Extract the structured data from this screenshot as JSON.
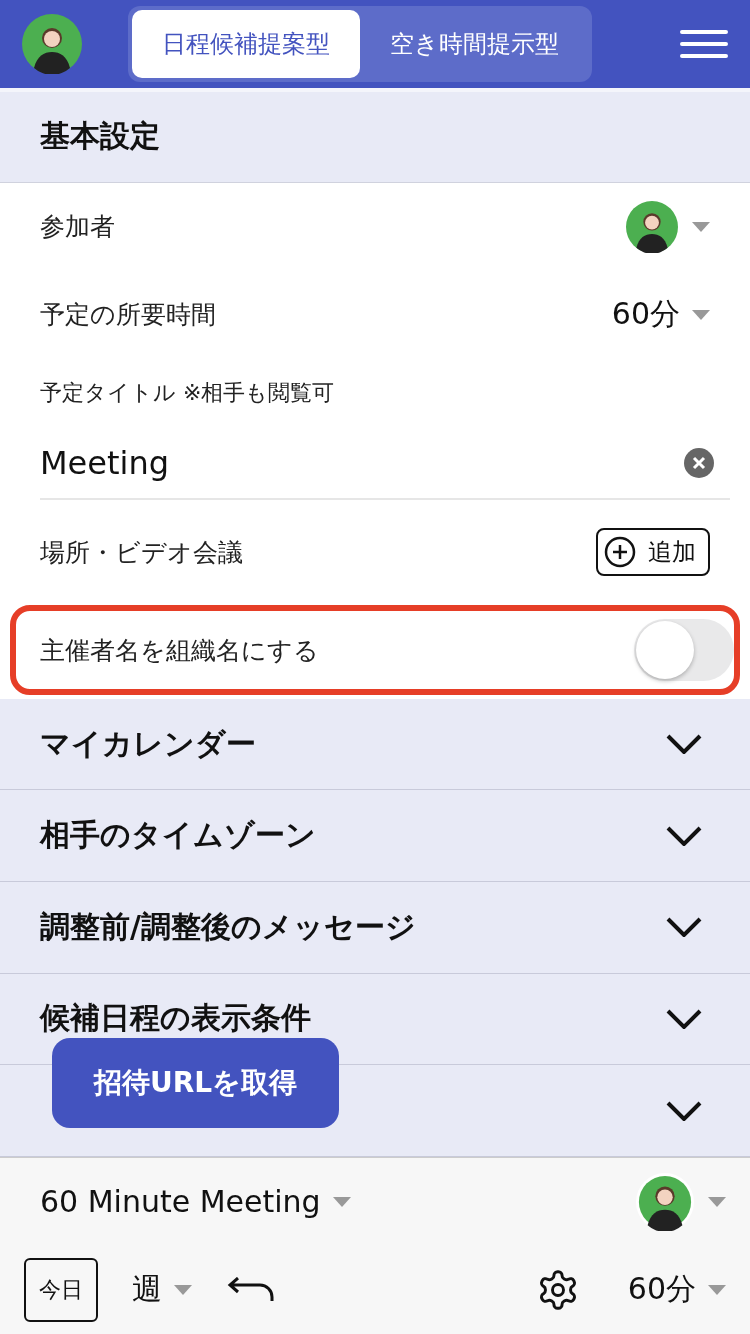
{
  "header": {
    "tabs": [
      {
        "label": "日程候補提案型",
        "selected": true
      },
      {
        "label": "空き時間提示型",
        "selected": false
      }
    ]
  },
  "basic": {
    "title": "基本設定",
    "participants": {
      "label": "参加者"
    },
    "duration": {
      "label": "予定の所要時間",
      "value": "60分"
    },
    "event_title": {
      "label": "予定タイトル ※相手も閲覧可",
      "value": "Meeting"
    },
    "location": {
      "label": "場所・ビデオ会議",
      "button": "追加"
    },
    "organizer_toggle": {
      "label": "主催者名を組織名にする",
      "on": false,
      "highlighted": true
    }
  },
  "sections": [
    {
      "title": "マイカレンダー",
      "expanded": false
    },
    {
      "title": "相手のタイムゾーン",
      "expanded": false
    },
    {
      "title": "調整前/調整後のメッセージ",
      "expanded": false
    },
    {
      "title": "候補日程の表示条件",
      "expanded": false
    },
    {
      "expanded": false
    }
  ],
  "floating_button": "招待URLを取得",
  "footer": {
    "meeting_type": "60 Minute Meeting",
    "today": "今日",
    "view": "週",
    "slot": "60分"
  }
}
